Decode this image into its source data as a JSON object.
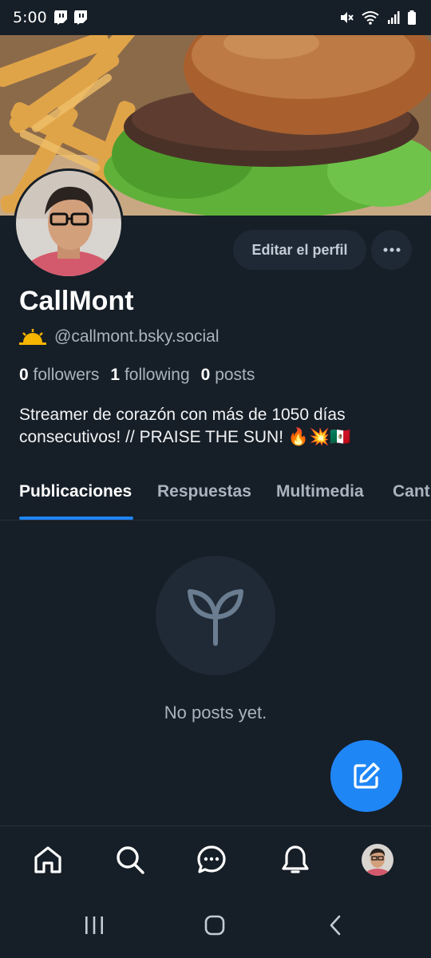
{
  "status_bar": {
    "time": "5:00",
    "left_icons": [
      "twitch-icon",
      "twitch-icon"
    ],
    "right_icons": [
      "mute-icon",
      "wifi-icon",
      "signal-icon",
      "battery-icon"
    ]
  },
  "profile": {
    "display_name": "CallMont",
    "handle": "@callmont.bsky.social",
    "handle_emoji": "sunrise-icon",
    "stats": {
      "followers_count": "0",
      "followers_label": "followers",
      "following_count": "1",
      "following_label": "following",
      "posts_count": "0",
      "posts_label": "posts"
    },
    "bio_line1": "Streamer de corazón con más de 1050 días",
    "bio_line2": "consecutivos! // PRAISE THE SUN! 🔥💥🇲🇽"
  },
  "actions": {
    "edit_profile": "Editar el perfil",
    "more_icon": "ellipsis-icon"
  },
  "tabs": [
    {
      "label": "Publicaciones",
      "active": true
    },
    {
      "label": "Respuestas",
      "active": false
    },
    {
      "label": "Multimedia",
      "active": false
    },
    {
      "label": "Cant",
      "active": false
    }
  ],
  "empty_state": {
    "icon": "sprout-icon",
    "message": "No posts yet."
  },
  "fab": {
    "icon": "compose-icon"
  },
  "bottom_nav": [
    "home-icon",
    "search-icon",
    "chat-icon",
    "bell-icon",
    "avatar"
  ],
  "system_nav": [
    "recents-icon",
    "home-icon",
    "back-icon"
  ],
  "colors": {
    "background": "#161e27",
    "accent": "#1f86f6",
    "muted_text": "#a9b4bf"
  }
}
